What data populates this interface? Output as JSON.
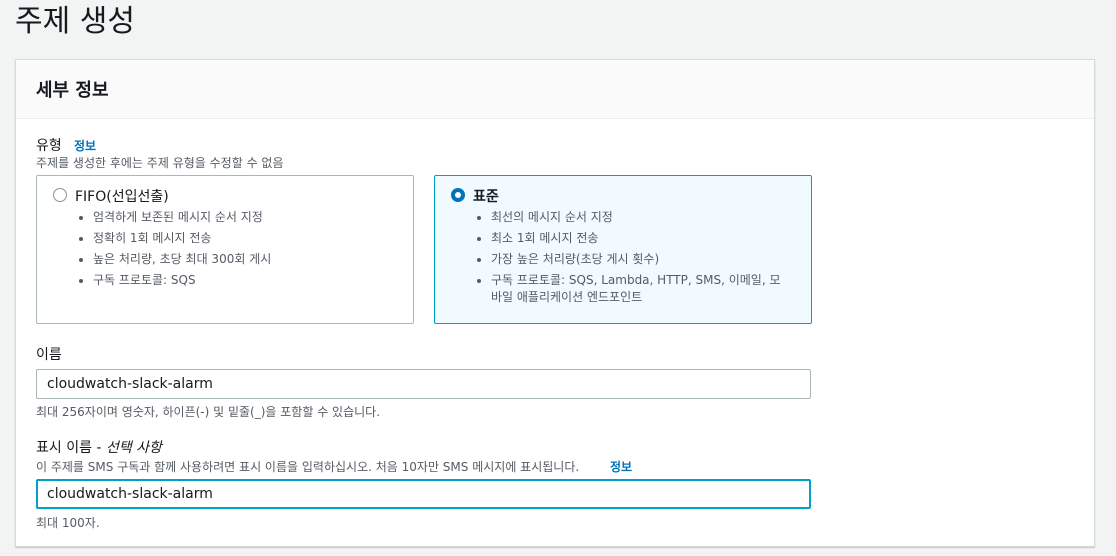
{
  "page": {
    "title": "주제 생성"
  },
  "panel": {
    "title": "세부 정보"
  },
  "type_field": {
    "label": "유형",
    "info": "정보",
    "description": "주제를 생성한 후에는 주제 유형을 수정할 수 없음",
    "options": [
      {
        "title": "FIFO(선입선출)",
        "selected": false,
        "bullets": [
          "엄격하게 보존된 메시지 순서 지정",
          "정확히 1회 메시지 전송",
          "높은 처리량, 초당 최대 300회 게시",
          "구독 프로토콜: SQS"
        ]
      },
      {
        "title": "표준",
        "selected": true,
        "bullets": [
          "최선의 메시지 순서 지정",
          "최소 1회 메시지 전송",
          "가장 높은 처리량(초당 게시 횟수)",
          "구독 프로토콜: SQS, Lambda, HTTP, SMS, 이메일, 모바일 애플리케이션 엔드포인트"
        ]
      }
    ]
  },
  "name_field": {
    "label": "이름",
    "value": "cloudwatch-slack-alarm",
    "hint": "최대 256자이며 영숫자, 하이픈(-) 및 밑줄(_)을 포함할 수 있습니다."
  },
  "display_name_field": {
    "label": "표시 이름 - ",
    "optional": "선택 사항",
    "description": "이 주제를 SMS 구독과 함께 사용하려면 표시 이름을 입력하십시오. 처음 10자만 SMS 메시지에 표시됩니다.",
    "info": "정보",
    "value": "cloudwatch-slack-alarm",
    "hint": "최대 100자."
  },
  "colors": {
    "accent": "#0073bb",
    "selected_border": "#00a1c9",
    "selected_bg": "#f1faff"
  }
}
